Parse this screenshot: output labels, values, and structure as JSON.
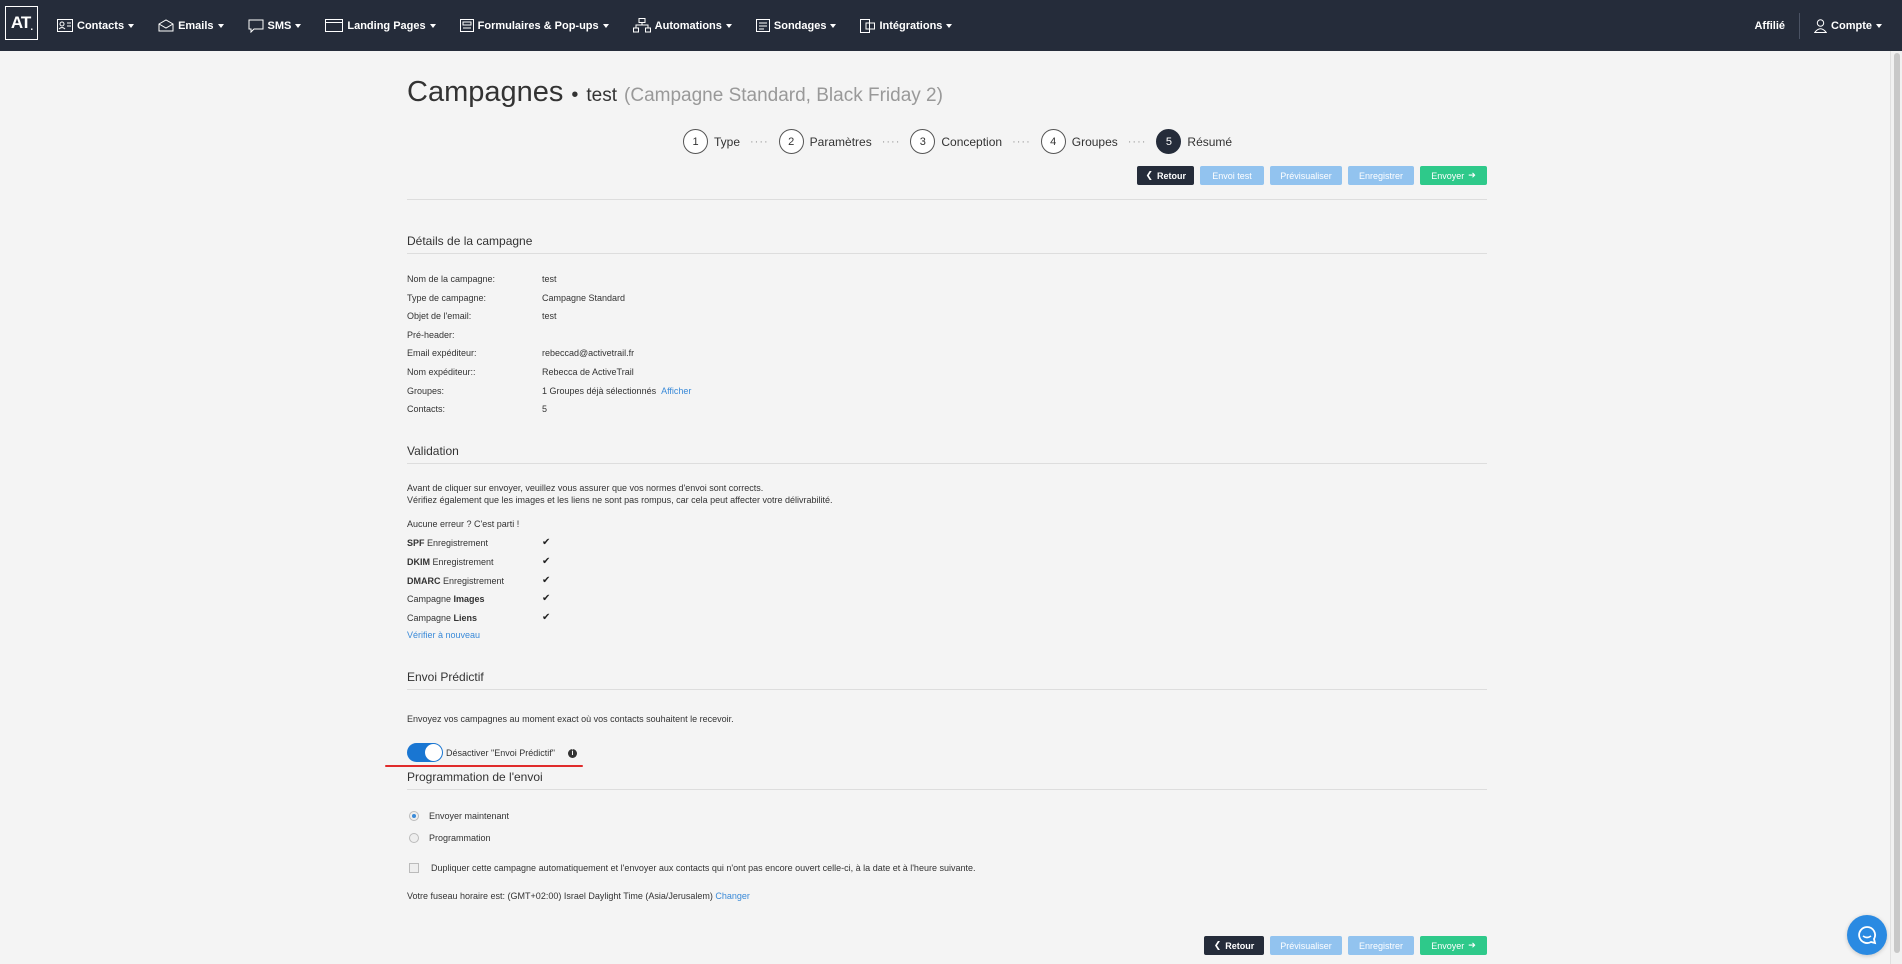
{
  "nav": {
    "logo": "AT",
    "items": [
      {
        "label": "Contacts",
        "icon": "contacts-icon"
      },
      {
        "label": "Emails",
        "icon": "envelope-icon"
      },
      {
        "label": "SMS",
        "icon": "chat-bubble-icon"
      },
      {
        "label": "Landing Pages",
        "icon": "browser-window-icon"
      },
      {
        "label": "Formulaires & Pop-ups",
        "icon": "form-icon"
      },
      {
        "label": "Automations",
        "icon": "flow-icon"
      },
      {
        "label": "Sondages",
        "icon": "survey-icon"
      },
      {
        "label": "Intégrations",
        "icon": "integrations-icon"
      }
    ],
    "affiliate": "Affilié",
    "account": "Compte"
  },
  "page": {
    "title": "Campagnes",
    "campaign_name": "test",
    "campaign_info": "(Campagne Standard, Black Friday 2)"
  },
  "steps": [
    {
      "num": "1",
      "label": "Type"
    },
    {
      "num": "2",
      "label": "Paramètres"
    },
    {
      "num": "3",
      "label": "Conception"
    },
    {
      "num": "4",
      "label": "Groupes"
    },
    {
      "num": "5",
      "label": "Résumé"
    }
  ],
  "toolbar_top": {
    "back": "Retour",
    "test": "Envoi test",
    "preview": "Prévisualiser",
    "save": "Enregistrer",
    "send": "Envoyer"
  },
  "toolbar_bottom": {
    "back": "Retour",
    "preview": "Prévisualiser",
    "save": "Enregistrer",
    "send": "Envoyer"
  },
  "details": {
    "title": "Détails de la campagne",
    "rows": [
      {
        "key": "Nom de la campagne:",
        "value": "test"
      },
      {
        "key": "Type de campagne:",
        "value": "Campagne Standard"
      },
      {
        "key": "Objet de l'email:",
        "value": "test"
      },
      {
        "key": "Pré-header:",
        "value": ""
      },
      {
        "key": "Email expéditeur:",
        "value": "rebeccad@activetrail.fr"
      },
      {
        "key": "Nom expéditeur::",
        "value": "Rebecca de ActiveTrail"
      },
      {
        "key": "Groupes:",
        "value": "1 Groupes déjà sélectionnés"
      },
      {
        "key": "Contacts:",
        "value": "5"
      }
    ],
    "show_link": "Afficher"
  },
  "validation": {
    "title": "Validation",
    "text1": "Avant de cliquer sur envoyer, veuillez vous assurer que vos normes d'envoi sont corrects.",
    "text2": "Vérifiez également que les images et les liens ne sont pas rompus, car cela peut affecter votre délivrabilité.",
    "ok_text": "Aucune erreur ? C'est parti !",
    "checks": [
      {
        "bold": "SPF",
        "rest": " Enregistrement",
        "bold_first": true
      },
      {
        "bold": "DKIM",
        "rest": " Enregistrement",
        "bold_first": true
      },
      {
        "bold": "DMARC",
        "rest": " Enregistrement",
        "bold_first": true
      },
      {
        "bold": "Images",
        "rest": "Campagne ",
        "bold_first": false
      },
      {
        "bold": "Liens",
        "rest": "Campagne ",
        "bold_first": false
      }
    ],
    "tick": "✔",
    "recheck": "Vérifier à nouveau"
  },
  "predictive": {
    "title": "Envoi Prédictif",
    "desc": "Envoyez vos campagnes au moment exact où vos contacts souhaitent le recevoir.",
    "toggle_label": "Désactiver \"Envoi Prédictif\"",
    "toggle_on": true,
    "info": "i"
  },
  "schedule": {
    "title": "Programmation de l'envoi",
    "opt_now": "Envoyer maintenant",
    "opt_schedule": "Programmation",
    "duplicate": "Dupliquer cette campagne automatiquement et l'envoyer aux contacts qui n'ont pas encore ouvert celle-ci, à la date et à l'heure suivante.",
    "timezone": "Votre fuseau horaire est: (GMT+02:00) Israel Daylight Time (Asia/Jerusalem)",
    "change": "Changer"
  }
}
